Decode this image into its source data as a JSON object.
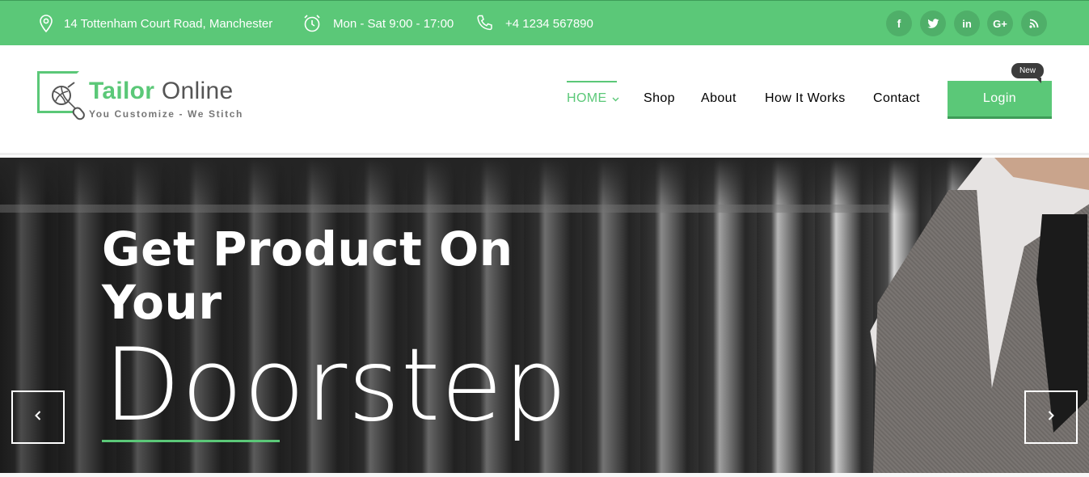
{
  "topbar": {
    "address": "14 Tottenham Court Road, Manchester",
    "hours": "Mon - Sat 9:00 - 17:00",
    "phone": "+4 1234 567890",
    "social": [
      {
        "icon": "facebook-icon",
        "glyph": "f"
      },
      {
        "icon": "twitter-icon",
        "glyph": "t"
      },
      {
        "icon": "linkedin-icon",
        "glyph": "in"
      },
      {
        "icon": "google-plus-icon",
        "glyph": "G+"
      },
      {
        "icon": "rss-icon",
        "glyph": "rss"
      }
    ]
  },
  "logo": {
    "name_part1": "Tailor",
    "name_part2": "Online",
    "tagline": "You Customize - We Stitch"
  },
  "nav": {
    "home": "HOME",
    "shop": "Shop",
    "about": "About",
    "how_it_works": "How It Works",
    "contact": "Contact",
    "login": "Login",
    "badge": "New"
  },
  "hero": {
    "title": "Get Product On Your",
    "big_word": "Doorstep"
  },
  "colors": {
    "accent": "#5bc878",
    "accent_dark": "#3e9c58",
    "badge_bg": "#3c3c3c"
  }
}
